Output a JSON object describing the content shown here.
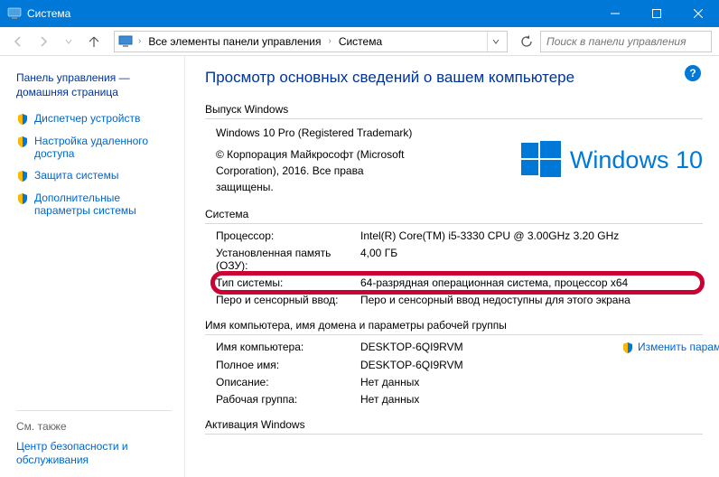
{
  "window": {
    "title": "Система"
  },
  "breadcrumb": {
    "all_items": "Все элементы панели управления",
    "current": "Система"
  },
  "search": {
    "placeholder": "Поиск в панели управления"
  },
  "sidebar": {
    "home": "Панель управления — домашняя страница",
    "links": [
      "Диспетчер устройств",
      "Настройка удаленного доступа",
      "Защита системы",
      "Дополнительные параметры системы"
    ],
    "see_also_h": "См. также",
    "see_also_link": "Центр безопасности и обслуживания"
  },
  "content": {
    "title": "Просмотр основных сведений о вашем компьютере",
    "sec_edition": "Выпуск Windows",
    "edition_name": "Windows 10 Pro (Registered Trademark)",
    "copyright": "© Корпорация Майкрософт (Microsoft Corporation), 2016. Все права защищены.",
    "logo_text": "Windows 10",
    "sec_system": "Система",
    "sys": [
      {
        "k": "Процессор:",
        "v": "Intel(R) Core(TM) i5-3330 CPU @ 3.00GHz   3.20 GHz"
      },
      {
        "k": "Установленная память (ОЗУ):",
        "v": "4,00 ГБ"
      },
      {
        "k": "Тип системы:",
        "v": "64-разрядная операционная система, процессор x64"
      },
      {
        "k": "Перо и сенсорный ввод:",
        "v": "Перо и сенсорный ввод недоступны для этого экрана"
      }
    ],
    "sec_computer": "Имя компьютера, имя домена и параметры рабочей группы",
    "comp": [
      {
        "k": "Имя компьютера:",
        "v": "DESKTOP-6QI9RVM"
      },
      {
        "k": "Полное имя:",
        "v": "DESKTOP-6QI9RVM"
      },
      {
        "k": "Описание:",
        "v": "Нет данных"
      },
      {
        "k": "Рабочая группа:",
        "v": "Нет данных"
      }
    ],
    "change_link": "Изменить параметры",
    "sec_activation": "Активация Windows"
  }
}
